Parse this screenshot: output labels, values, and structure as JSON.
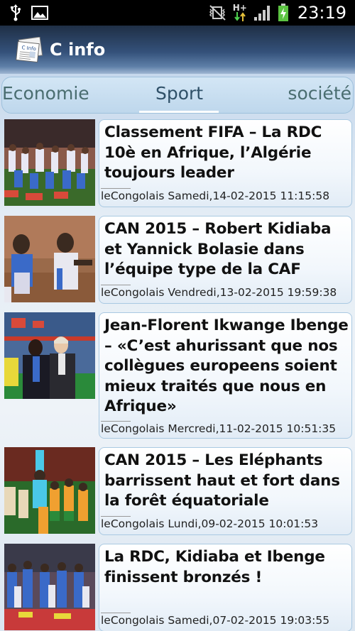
{
  "status_bar": {
    "time": "23:19",
    "network_label": "H+"
  },
  "app": {
    "title": "C info",
    "icon_label": "C Info"
  },
  "tabs": [
    {
      "label": "Economie",
      "selected": false
    },
    {
      "label": "Sport",
      "selected": true
    },
    {
      "label": "société",
      "selected": false
    }
  ],
  "news": [
    {
      "headline": "Classement FIFA – La RDC 10è en Afrique, l’Algérie toujours leader",
      "meta": "leCongolais Samedi,14-02-2015 11:15:58"
    },
    {
      "headline": "CAN 2015 – Robert Kidiaba et Yannick Bolasie dans l’équipe type de la CAF",
      "meta": "leCongolais Vendredi,13-02-2015 19:59:38"
    },
    {
      "headline": "Jean-Florent Ikwange Ibenge – «C’est ahurissant que nos collègues europeens soient mieux traités que nous en Afrique»",
      "meta": "leCongolais Mercredi,11-02-2015 10:51:35"
    },
    {
      "headline": "CAN 2015 – Les Eléphants barrissent haut et fort dans la forêt équatoriale",
      "meta": "leCongolais Lundi,09-02-2015 10:01:53"
    },
    {
      "headline": "La RDC, Kidiaba et Ibenge finissent bronzés !",
      "meta": "leCongolais Samedi,07-02-2015 19:03:55"
    }
  ],
  "colors": {
    "action_bar": "#34517a",
    "tab_text": "#3b6072",
    "card_border": "#a9c9e2"
  }
}
